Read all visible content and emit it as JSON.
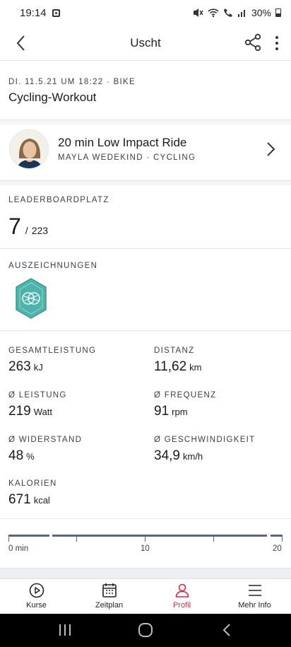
{
  "status_bar": {
    "time": "19:14",
    "battery": "30%"
  },
  "app_bar": {
    "title": "Uscht"
  },
  "workout": {
    "meta": "DI. 11.5.21 UM 18:22 · BIKE",
    "title": "Cycling-Workout"
  },
  "class": {
    "title": "20 min Low Impact Ride",
    "subtitle": "MAYLA WEDEKIND · CYCLING"
  },
  "leaderboard": {
    "heading": "LEADERBOARDPLATZ",
    "rank": "7",
    "separator": "/",
    "total": "223"
  },
  "awards": {
    "heading": "AUSZEICHNUNGEN",
    "badge_icon": "cycling-award-badge-icon",
    "badge_color": "#4fb3ab"
  },
  "stats": [
    {
      "label": "GESAMTLEISTUNG",
      "value": "263",
      "unit": "kJ"
    },
    {
      "label": "DISTANZ",
      "value": "11,62",
      "unit": "km"
    },
    {
      "label": "Ø LEISTUNG",
      "value": "219",
      "unit": "Watt"
    },
    {
      "label": "Ø FREQUENZ",
      "value": "91",
      "unit": "rpm"
    },
    {
      "label": "Ø WIDERSTAND",
      "value": "48",
      "unit": "%"
    },
    {
      "label": "Ø GESCHWINDIGKEIT",
      "value": "34,9",
      "unit": "km/h"
    },
    {
      "label": "KALORIEN",
      "value": "671",
      "unit": "kcal"
    }
  ],
  "timeline": {
    "labels": [
      "0 min",
      "10",
      "20"
    ]
  },
  "bottom_nav": [
    {
      "label": "Kurse",
      "icon": "play-circle-icon",
      "active": false
    },
    {
      "label": "Zeitplan",
      "icon": "calendar-icon",
      "active": false
    },
    {
      "label": "Profil",
      "icon": "profile-icon",
      "active": true
    },
    {
      "label": "Mehr Info",
      "icon": "menu-icon",
      "active": false
    }
  ],
  "colors": {
    "accent": "#d52b3c",
    "background": "#f4f5f7"
  }
}
